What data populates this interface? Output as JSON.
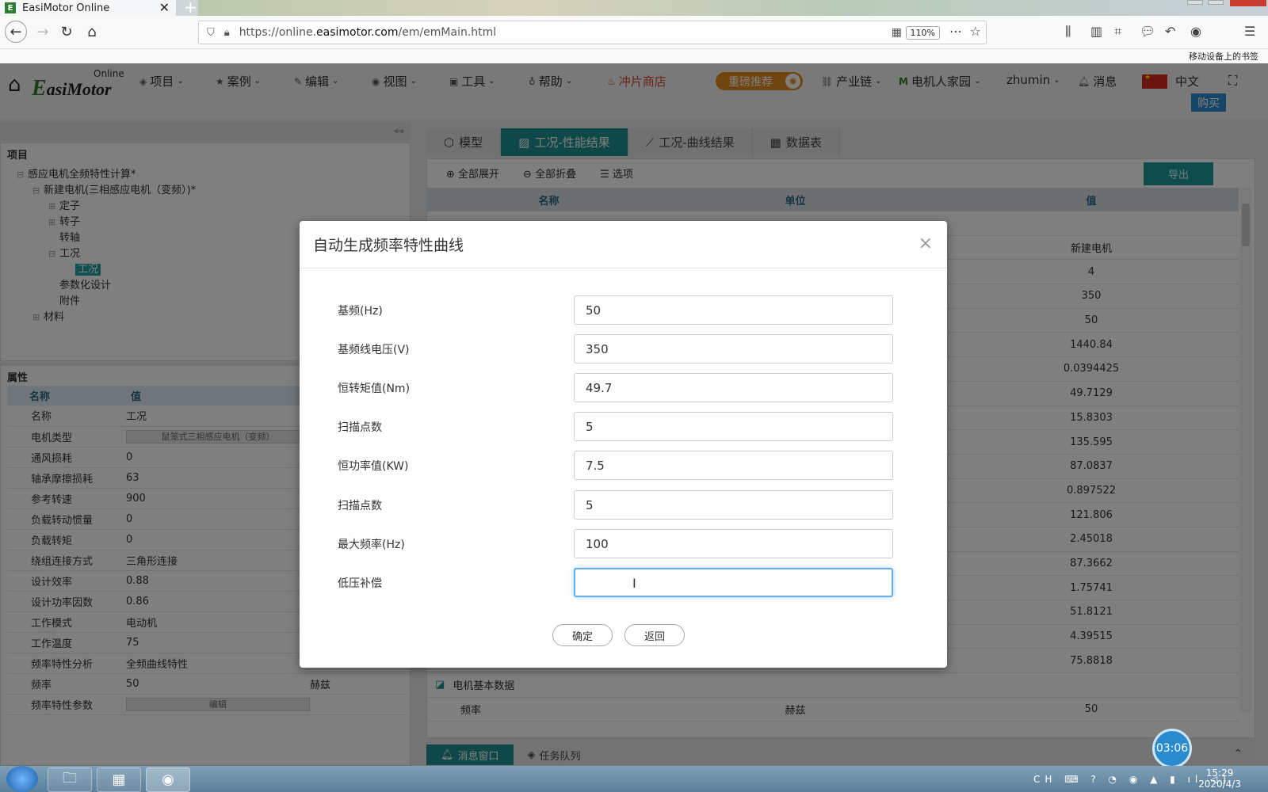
{
  "browser": {
    "tab_title": "EasiMotor Online",
    "url_prefix": "https://online.",
    "url_domain": "easimotor.com",
    "url_path": "/em/emMain.html",
    "zoom": "110%",
    "bookmark_label": "移动设备上的书签"
  },
  "app": {
    "logo_word": "asiMotor",
    "logo_online": "Online",
    "menu": [
      "项目",
      "案例",
      "编辑",
      "视图",
      "工具",
      "帮助"
    ],
    "shop": "冲片商店",
    "promo": "重磅推荐",
    "chain": "产业链",
    "community": "电机人家园",
    "user": "zhumin",
    "messages": "消息",
    "language": "中文",
    "buy": "购买"
  },
  "project": {
    "title": "项目",
    "tree": [
      {
        "label": "感应电机全频特性计算*"
      },
      {
        "label": "新建电机(三相感应电机（变频）)*"
      },
      {
        "label": "定子"
      },
      {
        "label": "转子"
      },
      {
        "label": "转轴"
      },
      {
        "label": "工况"
      },
      {
        "label": "工况"
      },
      {
        "label": "参数化设计"
      },
      {
        "label": "附件"
      },
      {
        "label": "材料"
      }
    ]
  },
  "properties": {
    "title": "属性",
    "col_name": "名称",
    "col_value": "值",
    "rows": [
      {
        "name": "名称",
        "value": "工况",
        "unit": ""
      },
      {
        "name": "电机类型",
        "value": "鼠笼式三相感应电机（变频）",
        "unit": ""
      },
      {
        "name": "通风损耗",
        "value": "0",
        "unit": ""
      },
      {
        "name": "轴承摩擦损耗",
        "value": "63",
        "unit": ""
      },
      {
        "name": "参考转速",
        "value": "900",
        "unit": ""
      },
      {
        "name": "负载转动惯量",
        "value": "0",
        "unit": ""
      },
      {
        "name": "负载转矩",
        "value": "0",
        "unit": ""
      },
      {
        "name": "绕组连接方式",
        "value": "三角形连接",
        "unit": ""
      },
      {
        "name": "设计效率",
        "value": "0.88",
        "unit": ""
      },
      {
        "name": "设计功率因数",
        "value": "0.86",
        "unit": ""
      },
      {
        "name": "工作模式",
        "value": "电动机",
        "unit": ""
      },
      {
        "name": "工作温度",
        "value": "75",
        "unit": ""
      },
      {
        "name": "频率特性分析",
        "value": "全频曲线特性",
        "unit": ""
      },
      {
        "name": "频率",
        "value": "50",
        "unit": "赫兹"
      },
      {
        "name": "频率特性参数",
        "value": "编辑",
        "unit": ""
      }
    ]
  },
  "results": {
    "tabs": [
      "模型",
      "工况-性能结果",
      "工况-曲线结果",
      "数据表"
    ],
    "toolbar": [
      "全部展开",
      "全部折叠",
      "选项"
    ],
    "export": "导出",
    "col_name": "名称",
    "col_unit": "单位",
    "col_value": "值",
    "values": [
      "新建电机",
      "4",
      "350",
      "50",
      "1440.84",
      "0.0394425",
      "49.7129",
      "15.8303",
      "135.595",
      "87.0837",
      "0.897522",
      "121.806",
      "2.45018",
      "87.3662",
      "1.75741",
      "51.8121",
      "4.39515",
      "75.8818"
    ],
    "section2": "电机基本数据",
    "last_row": {
      "name": "频率",
      "unit": "赫兹",
      "value": "50"
    },
    "bottom_tabs": [
      "消息窗口",
      "任务队列"
    ]
  },
  "modal": {
    "title": "自动生成频率特性曲线",
    "fields": [
      {
        "label": "基频(Hz)",
        "value": "50"
      },
      {
        "label": "基频线电压(V)",
        "value": "350"
      },
      {
        "label": "恒转矩值(Nm)",
        "value": "49.7"
      },
      {
        "label": "扫描点数",
        "value": "5"
      },
      {
        "label": "恒功率值(KW)",
        "value": "7.5"
      },
      {
        "label": "扫描点数",
        "value": "5"
      },
      {
        "label": "最大频率(Hz)",
        "value": "100"
      },
      {
        "label": "低压补偿",
        "value": ""
      }
    ],
    "ok": "确定",
    "back": "返回"
  },
  "timer": "03:06",
  "taskbar": {
    "time": "15:29",
    "date": "2020/4/3"
  },
  "colors": {
    "teal": "#1e9090",
    "promo": "#e28a1e",
    "buy": "#2a8ccf"
  }
}
